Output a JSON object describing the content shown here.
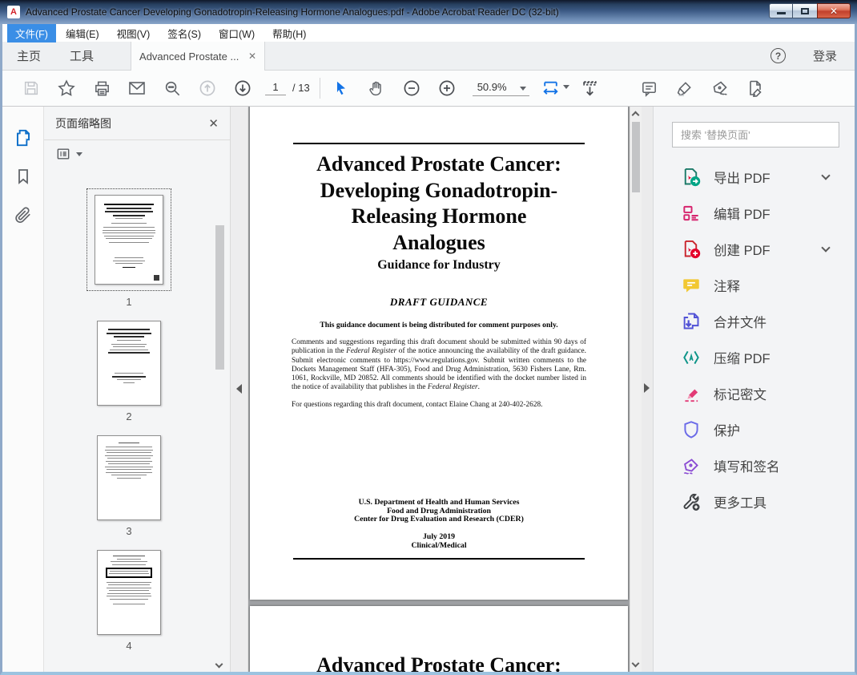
{
  "window": {
    "title": "Advanced Prostate Cancer Developing Gonadotropin-Releasing Hormone Analogues.pdf - Adobe Acrobat Reader DC (32-bit)"
  },
  "menu": {
    "items": [
      {
        "label": "文件(F)"
      },
      {
        "label": "编辑(E)"
      },
      {
        "label": "视图(V)"
      },
      {
        "label": "签名(S)"
      },
      {
        "label": "窗口(W)"
      },
      {
        "label": "帮助(H)"
      }
    ]
  },
  "tabbar": {
    "home": "主页",
    "tools": "工具",
    "document_tab": "Advanced Prostate ...",
    "help": "?",
    "sign_in": "登录"
  },
  "toolbar": {
    "page_current": "1",
    "page_total": "/ 13",
    "zoom_level": "50.9%"
  },
  "left_panel": {
    "title": "页面缩略图",
    "thumbnails": [
      {
        "page": "1"
      },
      {
        "page": "2"
      },
      {
        "page": "3"
      },
      {
        "page": "4"
      }
    ]
  },
  "document": {
    "page1": {
      "title_line1": "Advanced Prostate Cancer:",
      "title_line2": "Developing Gonadotropin-",
      "title_line3": "Releasing Hormone",
      "title_line4": "Analogues",
      "subtitle": "Guidance for Industry",
      "draft_heading": "DRAFT GUIDANCE",
      "distribution_note": "This guidance document is being distributed for comment purposes only.",
      "para_parts": [
        "Comments and suggestions regarding this draft document should be submitted within 90 days of publication in the ",
        "Federal Register",
        " of the notice announcing the availability of the draft guidance.  Submit electronic comments to https://www.regulations.gov.  Submit written comments to the Dockets Management Staff (HFA-305), Food and Drug Administration, 5630 Fishers Lane, Rm. 1061, Rockville, MD  20852.  All comments should be identified with the docket number listed in the notice of availability that publishes in the ",
        "Federal Register",
        "."
      ],
      "contact_line": "For questions regarding this draft document, contact Elaine Chang at 240-402-2628.",
      "org_line1": "U.S. Department of Health and Human Services",
      "org_line2": "Food and Drug Administration",
      "org_line3": "Center for Drug Evaluation and Research (CDER)",
      "date_line": "July 2019",
      "category_line": "Clinical/Medical"
    },
    "page2": {
      "title_line1": "Advanced Prostate Cancer:"
    }
  },
  "right_panel": {
    "search_placeholder": "搜索 '替换页面'",
    "tools": [
      {
        "label": "导出 PDF"
      },
      {
        "label": "编辑 PDF"
      },
      {
        "label": "创建 PDF"
      },
      {
        "label": "注释"
      },
      {
        "label": "合并文件"
      },
      {
        "label": "压缩 PDF"
      },
      {
        "label": "标记密文"
      },
      {
        "label": "保护"
      },
      {
        "label": "填写和签名"
      },
      {
        "label": "更多工具"
      }
    ]
  },
  "colors": {
    "accent_blue": "#1373e6",
    "export_teal": "#00a485",
    "edit_magenta": "#d6246e",
    "create_red": "#e4002b",
    "comment_yellow": "#f2c832",
    "combine_indigo": "#5152d6",
    "compress_teal": "#0d9488",
    "redact_pink": "#e23a76",
    "protect_indigo": "#6a6ae8",
    "sign_purple": "#8a4bd3",
    "titlebar_blue": "#3c5a85"
  }
}
